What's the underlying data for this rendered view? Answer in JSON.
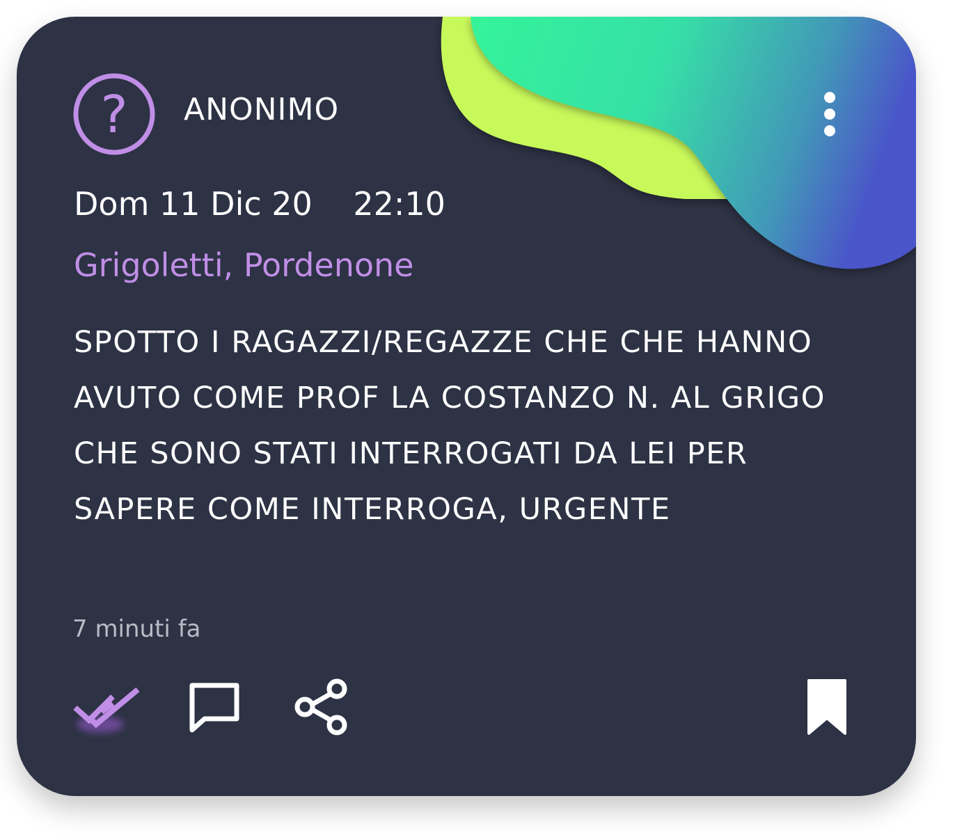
{
  "post": {
    "author": "ANONIMO",
    "date": "Dom 11 Dic 20",
    "time": "22:10",
    "location": "Grigoletti, Pordenone",
    "text": "SPOTTO I RAGAZZI/REGAZZE CHE CHE HANNO AVUTO COME PROF LA COSTANZO N. AL GRIGO CHE SONO STATI INTERROGATI DA LEI PER SAPERE COME INTERROGA, URGENTE",
    "posted_ago": "7 minuti fa"
  },
  "icons": {
    "avatar": "question-mark-circle-icon",
    "menu": "more-vertical-icon",
    "read": "double-check-icon",
    "comment": "comment-icon",
    "share": "share-icon",
    "save": "bookmark-icon"
  },
  "colors": {
    "card_background": "#2d3244",
    "accent_purple": "#c08ee6",
    "blob_lime": "#c8f95a",
    "blob_green": "#34f39a",
    "blob_blue": "#4a55c9"
  }
}
